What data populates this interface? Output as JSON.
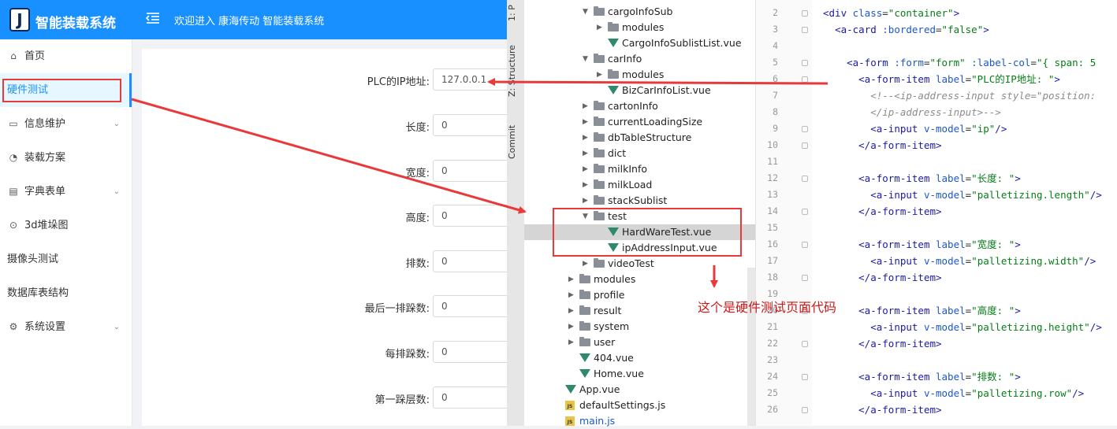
{
  "app": {
    "logo_letter": "J",
    "title": "智能装载系统",
    "welcome": "欢迎进入 康海传动 智能装载系统",
    "brand_color": "#1890ff"
  },
  "sidebar": {
    "items": [
      {
        "label": "首页",
        "icon": "home-icon"
      },
      {
        "label": "硬件测试",
        "icon": "",
        "active": true
      },
      {
        "label": "信息维护",
        "icon": "folder-icon",
        "expandable": true
      },
      {
        "label": "装载方案",
        "icon": "dashboard-icon"
      },
      {
        "label": "字典表单",
        "icon": "form-icon",
        "expandable": true
      },
      {
        "label": "3d堆垛图",
        "icon": "check-circle-icon"
      },
      {
        "label": "摄像头测试",
        "icon": ""
      },
      {
        "label": "数据库表结构",
        "icon": ""
      },
      {
        "label": "系统设置",
        "icon": "gear-icon",
        "expandable": true
      }
    ]
  },
  "form": {
    "fields": [
      {
        "label": "PLC的IP地址:",
        "value": "127.0.0.1"
      },
      {
        "label": "长度:",
        "value": "0"
      },
      {
        "label": "宽度:",
        "value": "0"
      },
      {
        "label": "高度:",
        "value": "0"
      },
      {
        "label": "排数:",
        "value": "0"
      },
      {
        "label": "最后一排跺数:",
        "value": "0"
      },
      {
        "label": "每排跺数:",
        "value": "0"
      },
      {
        "label": "第一跺层数:",
        "value": "0"
      }
    ]
  },
  "ide": {
    "side_tabs": [
      "1: P",
      "Z: Structure",
      "Commit"
    ],
    "tree": [
      {
        "name": "cargoInfoSub",
        "type": "folder",
        "expanded": true
      },
      {
        "name": "modules",
        "type": "folder",
        "expanded": false
      },
      {
        "name": "CargoInfoSublistList.vue",
        "type": "vue"
      },
      {
        "name": "carInfo",
        "type": "folder",
        "expanded": true
      },
      {
        "name": "modules",
        "type": "folder",
        "expanded": false
      },
      {
        "name": "BizCarInfoList.vue",
        "type": "vue"
      },
      {
        "name": "cartonInfo",
        "type": "folder",
        "expanded": false
      },
      {
        "name": "currentLoadingSize",
        "type": "folder",
        "expanded": false
      },
      {
        "name": "dbTableStructure",
        "type": "folder",
        "expanded": false
      },
      {
        "name": "dict",
        "type": "folder",
        "expanded": false
      },
      {
        "name": "milkInfo",
        "type": "folder",
        "expanded": false
      },
      {
        "name": "milkLoad",
        "type": "folder",
        "expanded": false
      },
      {
        "name": "stackSublist",
        "type": "folder",
        "expanded": false
      },
      {
        "name": "test",
        "type": "folder",
        "expanded": true
      },
      {
        "name": "HardWareTest.vue",
        "type": "vue",
        "selected": true
      },
      {
        "name": "ipAddressInput.vue",
        "type": "vue"
      },
      {
        "name": "videoTest",
        "type": "folder",
        "expanded": false
      },
      {
        "name": "modules",
        "type": "folder",
        "expanded": false
      },
      {
        "name": "profile",
        "type": "folder",
        "expanded": false
      },
      {
        "name": "result",
        "type": "folder",
        "expanded": false
      },
      {
        "name": "system",
        "type": "folder",
        "expanded": false
      },
      {
        "name": "user",
        "type": "folder",
        "expanded": false
      },
      {
        "name": "404.vue",
        "type": "vue"
      },
      {
        "name": "Home.vue",
        "type": "vue"
      },
      {
        "name": "App.vue",
        "type": "vue"
      },
      {
        "name": "defaultSettings.js",
        "type": "js"
      },
      {
        "name": "main.js",
        "type": "js"
      }
    ],
    "code_lines": [
      {
        "n": "2",
        "code": "<div class=\"container\">"
      },
      {
        "n": "3",
        "code": "  <a-card :bordered=\"false\">"
      },
      {
        "n": "4",
        "code": ""
      },
      {
        "n": "5",
        "code": "    <a-form :form=\"form\" :label-col=\"{ span: 5"
      },
      {
        "n": "6",
        "code": "      <a-form-item label=\"PLC的IP地址: \">"
      },
      {
        "n": "7",
        "code": "        <!--<ip-address-input style=\"position:"
      },
      {
        "n": "8",
        "code": "        </ip-address-input>-->"
      },
      {
        "n": "9",
        "code": "        <a-input v-model=\"ip\"/>"
      },
      {
        "n": "10",
        "code": "      </a-form-item>"
      },
      {
        "n": "11",
        "code": ""
      },
      {
        "n": "12",
        "code": "      <a-form-item label=\"长度: \">"
      },
      {
        "n": "13",
        "code": "        <a-input v-model=\"palletizing.length\"/>"
      },
      {
        "n": "14",
        "code": "      </a-form-item>"
      },
      {
        "n": "15",
        "code": ""
      },
      {
        "n": "16",
        "code": "      <a-form-item label=\"宽度: \">"
      },
      {
        "n": "17",
        "code": "        <a-input v-model=\"palletizing.width\"/>"
      },
      {
        "n": "18",
        "code": "      </a-form-item>"
      },
      {
        "n": "19",
        "code": ""
      },
      {
        "n": "20",
        "code": "      <a-form-item label=\"高度: \">"
      },
      {
        "n": "21",
        "code": "        <a-input v-model=\"palletizing.height\"/>"
      },
      {
        "n": "22",
        "code": "      </a-form-item>"
      },
      {
        "n": "23",
        "code": ""
      },
      {
        "n": "24",
        "code": "      <a-form-item label=\"排数: \">"
      },
      {
        "n": "25",
        "code": "        <a-input v-model=\"palletizing.row\"/>"
      },
      {
        "n": "26",
        "code": "      </a-form-item>"
      }
    ]
  },
  "annotation": {
    "note": "这个是硬件测试页面代码",
    "color": "#e8393b"
  }
}
